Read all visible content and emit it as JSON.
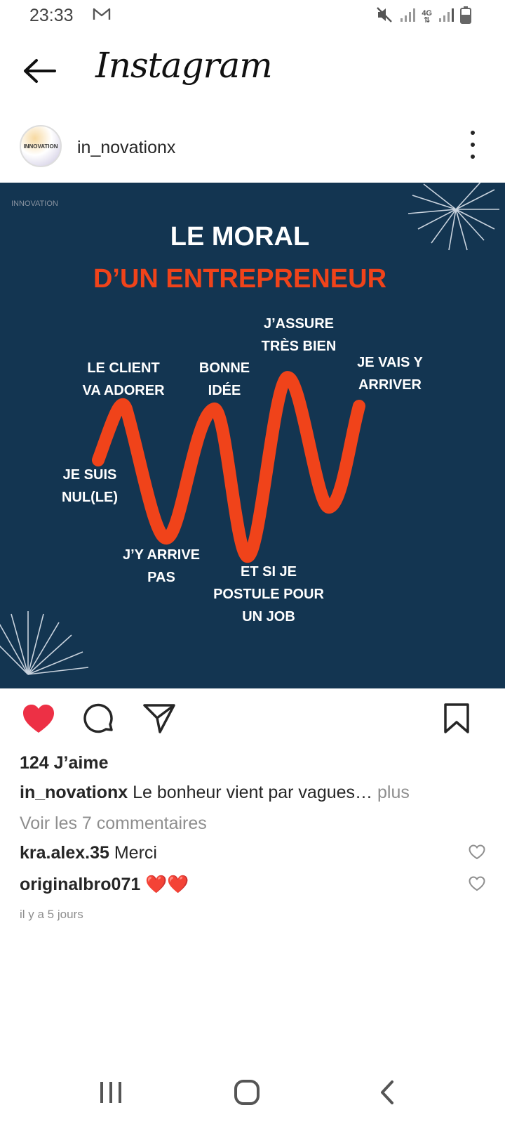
{
  "status_bar": {
    "time": "23:33",
    "network": "4G",
    "icons": [
      "gmail-icon",
      "mute-icon",
      "signal-icon",
      "signal-icon",
      "battery-icon"
    ]
  },
  "header": {
    "back_icon": "arrow-left-icon",
    "brand": "Instagram"
  },
  "post": {
    "username": "in_novationx",
    "avatar_text": "INNOVATION",
    "image": {
      "logo_text": "INNOVATION",
      "title_line1": "LE MORAL",
      "title_line2": "D’UN ENTREPRENEUR",
      "labels": {
        "nul": "JE SUIS\nNUL(LE)",
        "client": "LE CLIENT\nVA ADORER",
        "arrive_pas": "J’Y ARRIVE\nPAS",
        "bonne_idee": "BONNE\nIDÉE",
        "postule": "ET SI JE\nPOSTULE POUR\nUN JOB",
        "assure": "J’ASSURE\nTRÈS BIEN",
        "vais": "JE VAIS Y\nARRIVER"
      },
      "colors": {
        "background": "#133551",
        "accent": "#f0431a",
        "text": "#ffffff"
      }
    },
    "actions": [
      "heart-icon",
      "comment-icon",
      "share-icon",
      "bookmark-icon"
    ],
    "liked": true,
    "likes": "124 J’aime",
    "caption_user": "in_novationx",
    "caption_text": " Le bonheur vient par vagues… ",
    "caption_more": "plus",
    "view_comments": "Voir les 7 commentaires",
    "comments": [
      {
        "user": "kra.alex.35",
        "text": " Merci"
      },
      {
        "user": "originalbro071",
        "text": " ❤️❤️"
      }
    ],
    "time_ago": "il y a 5 jours"
  },
  "navbar": [
    "recents-icon",
    "home-icon",
    "back-icon"
  ]
}
